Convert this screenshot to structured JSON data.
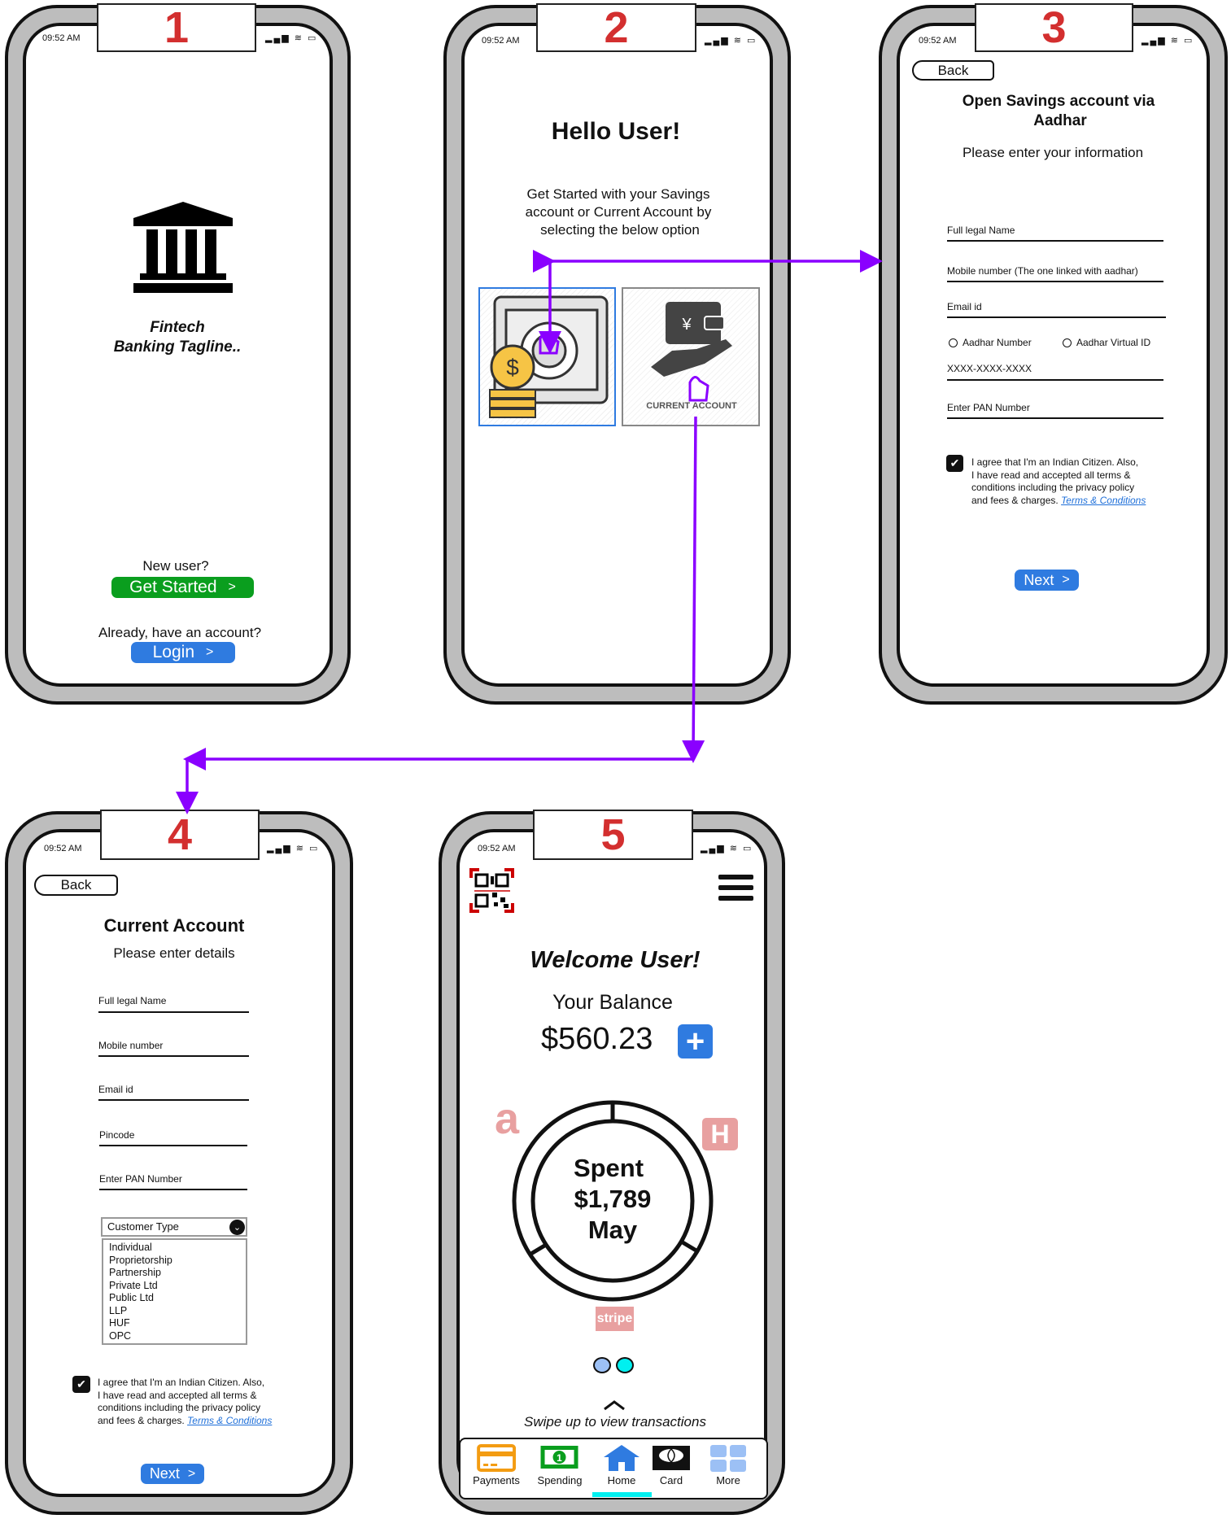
{
  "status_time": "09:52 AM",
  "status_icons": "signal wifi battery",
  "colors": {
    "arrow": "#8a00ff",
    "green": "#0a9e1e",
    "blue": "#2f7be0",
    "number": "#d32f2f",
    "cyan": "#00f0f0",
    "pink": "#e8a0a0"
  },
  "screen1": {
    "number": "1",
    "bank_icon": "bank-icon",
    "tagline_1": "Fintech",
    "tagline_2": "Banking Tagline..",
    "new_user": "New user?",
    "get_started": "Get Started",
    "already": "Already, have an account?",
    "login": "Login",
    "chevron": ">"
  },
  "screen2": {
    "number": "2",
    "title": "Hello User!",
    "subtitle_1": "Get Started with your Savings",
    "subtitle_2": "account or Current Account by",
    "subtitle_3": "selecting the below option",
    "current_label": "CURRENT ACCOUNT"
  },
  "screen3": {
    "number": "3",
    "back": "Back",
    "title_1": "Open Savings account via",
    "title_2": "Aadhar",
    "subtitle": "Please enter your information",
    "fields": [
      "Full legal Name",
      "Mobile number (The one linked with aadhar)",
      "Email id"
    ],
    "radio_1": "Aadhar Number",
    "radio_2": "Aadhar Virtual ID",
    "aadhar_value": "XXXX-XXXX-XXXX",
    "pan": "Enter PAN Number",
    "agree_1": "I agree that I'm an Indian Citizen. Also,",
    "agree_2": "I have read and accepted all terms &",
    "agree_3": "conditions including the privacy policy",
    "agree_4": "and fees & charges.",
    "terms": "Terms & Conditions",
    "agree_checked": true,
    "next": "Next"
  },
  "screen4": {
    "number": "4",
    "back": "Back",
    "title": "Current Account",
    "subtitle": "Please enter details",
    "fields": [
      "Full legal Name",
      "Mobile number",
      "Email id",
      "Pincode",
      "Enter PAN Number"
    ],
    "dropdown_label": "Customer Type",
    "options": [
      "Individual",
      "Proprietorship",
      "Partnership",
      "Private Ltd",
      "Public Ltd",
      "LLP",
      "HUF",
      "OPC"
    ],
    "agree_1": "I agree that I'm an Indian Citizen. Also,",
    "agree_2": "I have read and accepted all terms &",
    "agree_3": "conditions including the privacy policy",
    "agree_4": "and fees & charges.",
    "terms": "Terms & Conditions",
    "agree_checked": true,
    "next": "Next"
  },
  "screen5": {
    "number": "5",
    "welcome": "Welcome User!",
    "balance_label": "Your Balance",
    "balance": "$560.23",
    "spent_label": "Spent",
    "spent_amount": "$1,789",
    "spent_month": "May",
    "amazon_logo": "a",
    "h_logo": "H",
    "stripe_logo": "stripe",
    "swipe": "Swipe up to view transactions",
    "nav": [
      {
        "label": "Payments",
        "icon": "card-icon"
      },
      {
        "label": "Spending",
        "icon": "cash-icon"
      },
      {
        "label": "Home",
        "icon": "home-icon",
        "active": true
      },
      {
        "label": "Card",
        "icon": "mastercard-icon"
      },
      {
        "label": "More",
        "icon": "grid-icon"
      }
    ]
  }
}
